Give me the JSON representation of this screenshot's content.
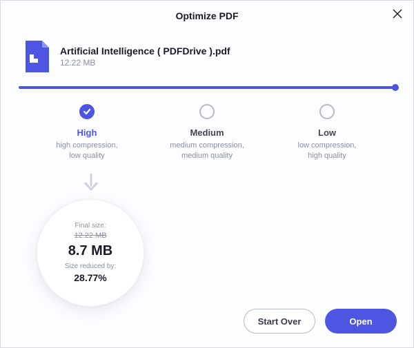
{
  "title": "Optimize PDF",
  "file": {
    "name": "Artificial Intelligence ( PDFDrive ).pdf",
    "size": "12.22 MB"
  },
  "options": [
    {
      "label": "High",
      "desc": "high compression,\nlow quality",
      "selected": true
    },
    {
      "label": "Medium",
      "desc": "medium compression,\nmedium quality",
      "selected": false
    },
    {
      "label": "Low",
      "desc": "low compression,\nhigh quality",
      "selected": false
    }
  ],
  "result": {
    "final_size_label": "Final size:",
    "original_size": "12.22 MB",
    "final_size": "8.7 MB",
    "reduced_label": "Size reduced by:",
    "reduced_pct": "28.77%"
  },
  "buttons": {
    "start_over": "Start Over",
    "open": "Open"
  },
  "colors": {
    "accent": "#4f55e3"
  }
}
